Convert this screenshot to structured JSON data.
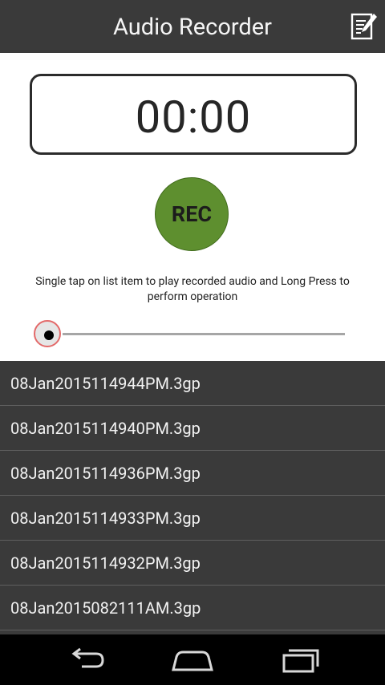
{
  "appbar": {
    "title": "Audio Recorder",
    "edit_icon": "edit-note-icon"
  },
  "timer": {
    "display": "00:00"
  },
  "record": {
    "label": "REC",
    "color": "#5e8f2f"
  },
  "hint": {
    "text": "Single tap on list item to play recorded audio  and Long Press to perform operation"
  },
  "seekbar": {
    "progress": 0
  },
  "recordings": [
    "08Jan2015114944PM.3gp",
    "08Jan2015114940PM.3gp",
    "08Jan2015114936PM.3gp",
    "08Jan2015114933PM.3gp",
    "08Jan2015114932PM.3gp",
    "08Jan2015082111AM.3gp"
  ],
  "navbar": {
    "back_icon": "back-icon",
    "home_icon": "home-icon",
    "recents_icon": "recents-icon"
  }
}
